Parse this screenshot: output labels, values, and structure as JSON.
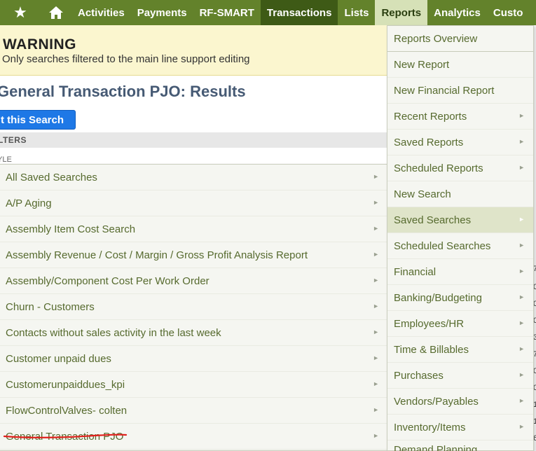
{
  "nav": {
    "items": [
      "Activities",
      "Payments",
      "RF-SMART",
      "Transactions",
      "Lists",
      "Reports",
      "Analytics",
      "Custo"
    ]
  },
  "warning": {
    "title": "WARNING",
    "text": "Only searches filtered to the main line support editing"
  },
  "page": {
    "title": "General Transaction PJO: Results",
    "edit_button": "t this Search",
    "filters_label": "LTERS",
    "style_label": "YLE"
  },
  "reports_menu": {
    "items": [
      {
        "label": "Reports Overview",
        "has_submenu": false
      },
      {
        "label": "New Report",
        "has_submenu": false
      },
      {
        "label": "New Financial Report",
        "has_submenu": false
      },
      {
        "label": "Recent Reports",
        "has_submenu": true
      },
      {
        "label": "Saved Reports",
        "has_submenu": true
      },
      {
        "label": "Scheduled Reports",
        "has_submenu": true
      },
      {
        "label": "New Search",
        "has_submenu": false
      },
      {
        "label": "Saved Searches",
        "has_submenu": true,
        "highlighted": true
      },
      {
        "label": "Scheduled Searches",
        "has_submenu": true
      },
      {
        "label": "Financial",
        "has_submenu": true
      },
      {
        "label": "Banking/Budgeting",
        "has_submenu": true
      },
      {
        "label": "Employees/HR",
        "has_submenu": true
      },
      {
        "label": "Time & Billables",
        "has_submenu": true
      },
      {
        "label": "Purchases",
        "has_submenu": true
      },
      {
        "label": "Vendors/Payables",
        "has_submenu": true
      },
      {
        "label": "Inventory/Items",
        "has_submenu": true
      },
      {
        "label": "Demand Planning",
        "has_submenu": true
      }
    ]
  },
  "saved_searches_menu": {
    "items": [
      {
        "label": "All Saved Searches"
      },
      {
        "label": "A/P Aging"
      },
      {
        "label": "Assembly Item Cost Search"
      },
      {
        "label": "Assembly Revenue / Cost / Margin / Gross Profit Analysis Report"
      },
      {
        "label": "Assembly/Component Cost Per Work Order"
      },
      {
        "label": "Churn - Customers"
      },
      {
        "label": "Contacts without sales activity in the last week"
      },
      {
        "label": "Customer unpaid dues"
      },
      {
        "label": "Customerunpaiddues_kpi"
      },
      {
        "label": "FlowControlValves- colten"
      },
      {
        "label": "General Transaction PJO"
      }
    ]
  },
  "edge_glyphs": [
    "7",
    "0",
    "0",
    "0",
    "3",
    "7",
    "0",
    "0",
    "1",
    "1",
    "6",
    "7",
    "7",
    "0"
  ],
  "colors": {
    "nav_bg": "#63822b",
    "nav_active": "#3e5a16",
    "menu_text": "#566a2e",
    "button": "#1e78e6",
    "underline": "#e0201c"
  }
}
